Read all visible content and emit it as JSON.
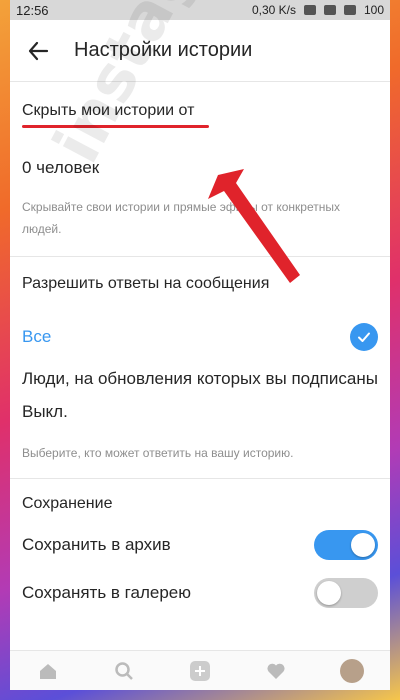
{
  "statusbar": {
    "time": "12:56",
    "network": "0,30 K/s",
    "battery": "100"
  },
  "header": {
    "title": "Настройки истории"
  },
  "hide": {
    "section_title": "Скрыть мои истории от",
    "count": "0 человек",
    "hint": "Скрывайте свои истории и прямые эфиры от конкретных людей."
  },
  "replies": {
    "section_title": "Разрешить ответы на сообщения",
    "options": [
      "Все",
      "Люди, на обновления которых вы подписаны",
      "Выкл."
    ],
    "selected": "Все",
    "hint": "Выберите, кто может ответить на вашу историю."
  },
  "saving": {
    "section_title": "Сохранение",
    "archive_label": "Сохранить в архив",
    "archive_on": true,
    "gallery_label": "Сохранять в галерею",
    "gallery_on": false
  },
  "watermark": "instagramm.help",
  "accent": "#3897f0",
  "annotation_color": "#e0232b"
}
